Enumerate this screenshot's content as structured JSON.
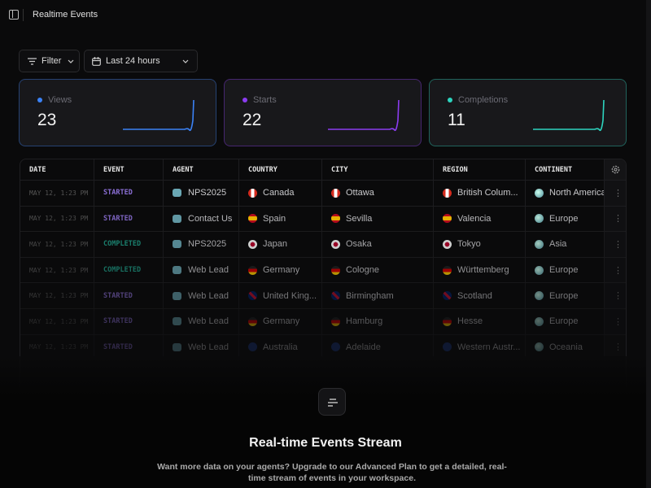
{
  "header": {
    "title": "Realtime Events"
  },
  "toolbar": {
    "filter_label": "Filter",
    "date_range": "Last 24 hours"
  },
  "stats": [
    {
      "label": "Views",
      "value": "23",
      "color": "#3b82f6"
    },
    {
      "label": "Starts",
      "value": "22",
      "color": "#8b3cf0"
    },
    {
      "label": "Completions",
      "value": "11",
      "color": "#2dd4bf"
    }
  ],
  "table": {
    "columns": [
      "DATE",
      "EVENT",
      "AGENT",
      "COUNTRY",
      "CITY",
      "REGION",
      "CONTINENT"
    ],
    "rows": [
      {
        "date": "MAY 12, 1:23 PM",
        "event": "STARTED",
        "agent": "NPS2025",
        "country": "Canada",
        "city": "Ottawa",
        "region": "British Colum...",
        "continent": "North America",
        "flag": "ca"
      },
      {
        "date": "MAY 12, 1:23 PM",
        "event": "STARTED",
        "agent": "Contact Us",
        "country": "Spain",
        "city": "Sevilla",
        "region": "Valencia",
        "continent": "Europe",
        "flag": "es"
      },
      {
        "date": "MAY 12, 1:23 PM",
        "event": "COMPLETED",
        "agent": "NPS2025",
        "country": "Japan",
        "city": "Osaka",
        "region": "Tokyo",
        "continent": "Asia",
        "flag": "jp"
      },
      {
        "date": "MAY 12, 1:23 PM",
        "event": "COMPLETED",
        "agent": "Web Lead",
        "country": "Germany",
        "city": "Cologne",
        "region": "Württemberg",
        "continent": "Europe",
        "flag": "de"
      },
      {
        "date": "MAY 12, 1:23 PM",
        "event": "STARTED",
        "agent": "Web Lead",
        "country": "United King...",
        "city": "Birmingham",
        "region": "Scotland",
        "continent": "Europe",
        "flag": "gb"
      },
      {
        "date": "MAY 12, 1:23 PM",
        "event": "STARTED",
        "agent": "Web Lead",
        "country": "Germany",
        "city": "Hamburg",
        "region": "Hesse",
        "continent": "Europe",
        "flag": "de"
      },
      {
        "date": "MAY 12, 1:23 PM",
        "event": "STARTED",
        "agent": "Web Lead",
        "country": "Australia",
        "city": "Adelaide",
        "region": "Western Austr...",
        "continent": "Oceania",
        "flag": "au"
      }
    ]
  },
  "event_colors": {
    "STARTED": "#8b6fd6",
    "COMPLETED": "#1f9c86"
  },
  "upsell": {
    "title": "Real-time Events Stream",
    "text": "Want more data on your agents? Upgrade to our Advanced Plan to get a detailed, real-time stream of events in your workspace."
  }
}
